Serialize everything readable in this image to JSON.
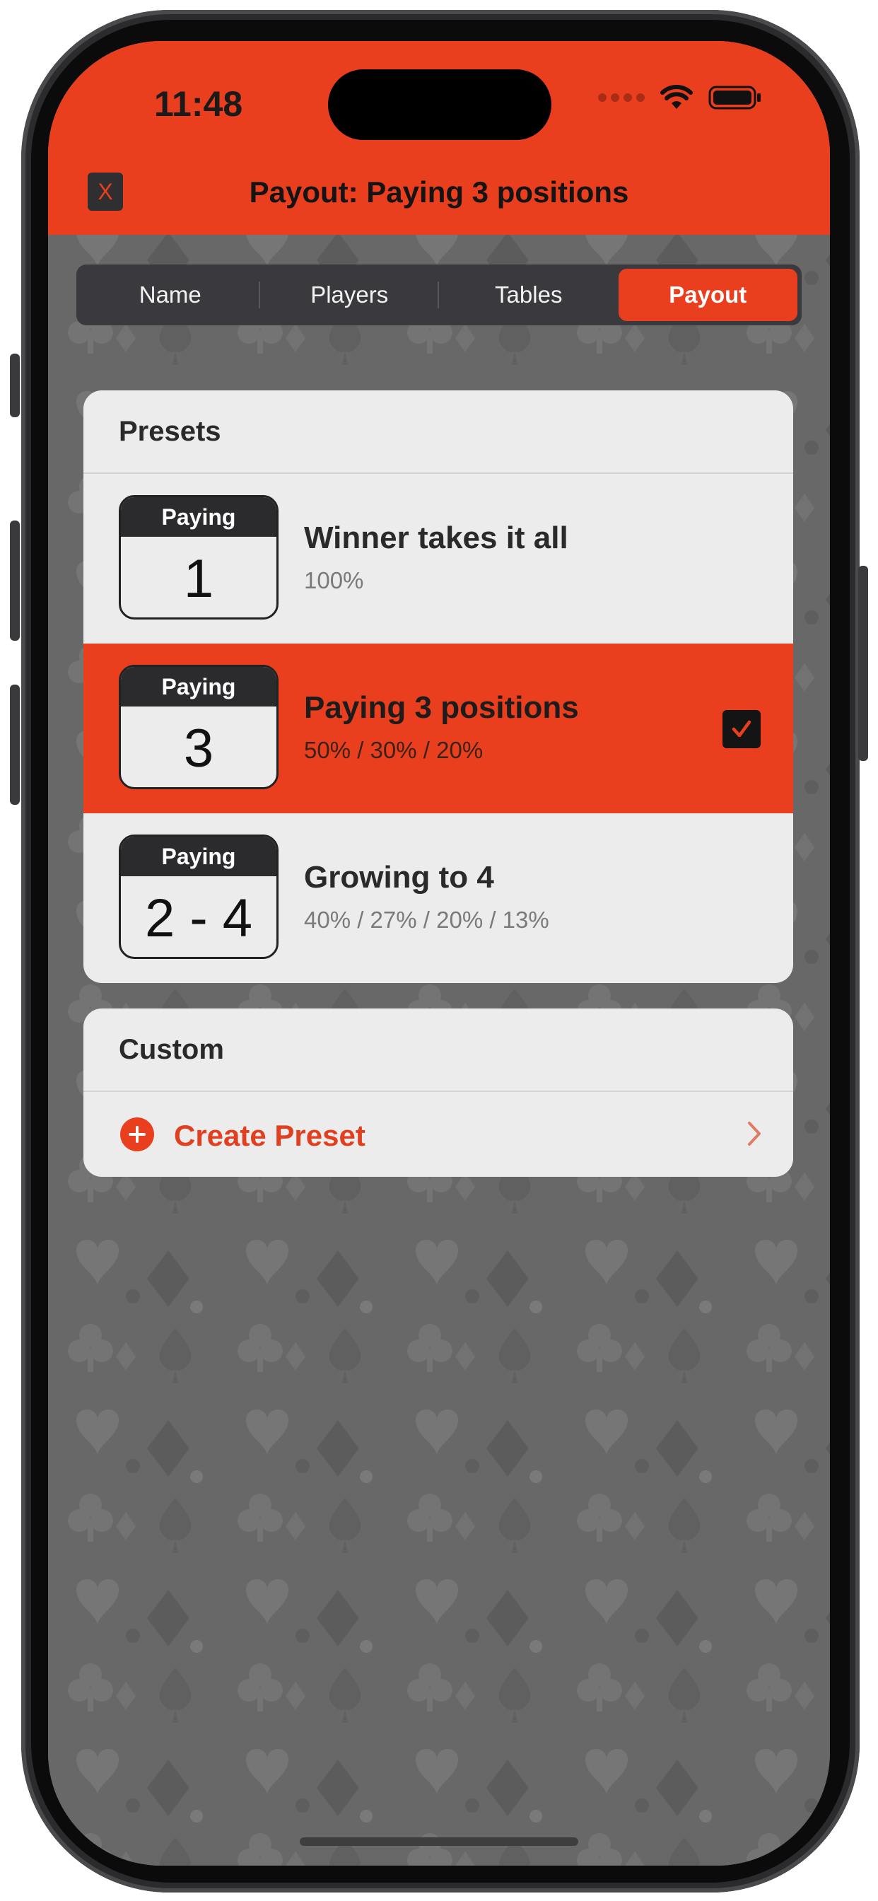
{
  "status_bar": {
    "time": "11:48"
  },
  "nav": {
    "close_label": "X",
    "title": "Payout: Paying 3 positions"
  },
  "tabs": [
    {
      "label": "Name",
      "active": false
    },
    {
      "label": "Players",
      "active": false
    },
    {
      "label": "Tables",
      "active": false
    },
    {
      "label": "Payout",
      "active": true
    }
  ],
  "presets_section": {
    "title": "Presets",
    "items": [
      {
        "badge_label": "Paying",
        "badge_value": "1",
        "title": "Winner takes it all",
        "subtitle": "100%",
        "selected": false
      },
      {
        "badge_label": "Paying",
        "badge_value": "3",
        "title": "Paying 3 positions",
        "subtitle": "50% / 30% / 20%",
        "selected": true
      },
      {
        "badge_label": "Paying",
        "badge_value": "2 - 4",
        "title": "Growing to 4",
        "subtitle": "40% / 27% / 20% / 13%",
        "selected": false
      }
    ]
  },
  "custom_section": {
    "title": "Custom",
    "create_label": "Create Preset"
  },
  "icons": {
    "wifi": "wifi-icon",
    "battery": "battery-icon",
    "check": "checkmark-icon",
    "plus": "plus-circle-icon",
    "chevron": "chevron-right-icon"
  },
  "colors": {
    "accent": "#ea3f1e",
    "card_bg": "#ececec",
    "background_pattern": "#6a6a6a",
    "segment_bg": "#3a3a3e"
  }
}
